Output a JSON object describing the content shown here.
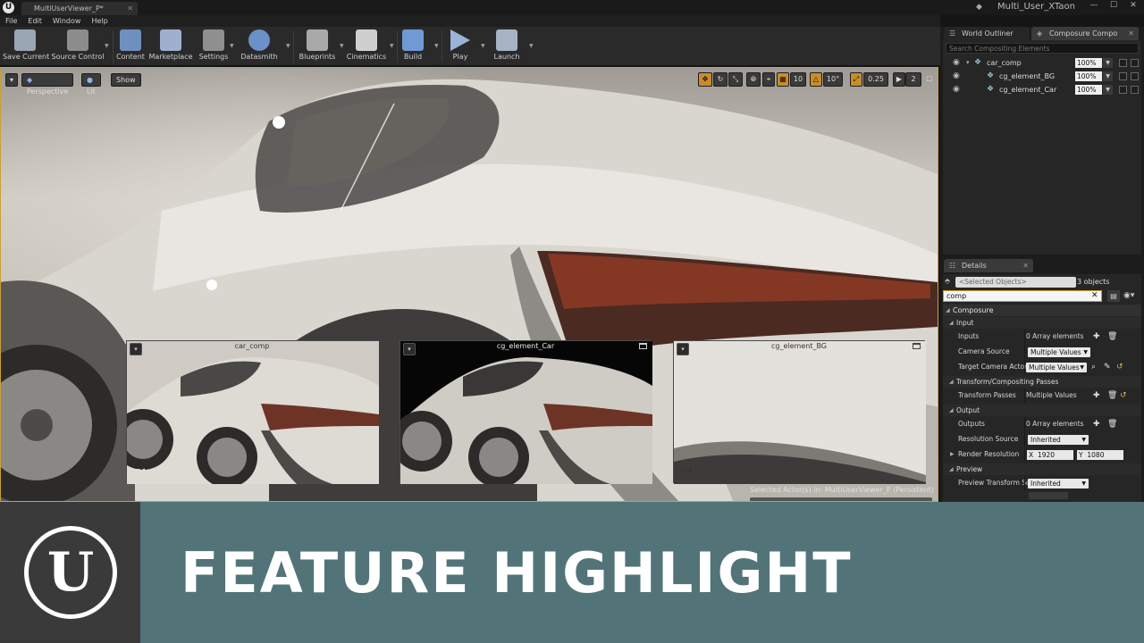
{
  "window": {
    "tab_title": "MultiUserViewer_P*",
    "project_name": "Multi_User_XTaon",
    "ue_logo": "U"
  },
  "menu": [
    "File",
    "Edit",
    "Window",
    "Help"
  ],
  "toolbar": {
    "buttons": [
      {
        "label": "Save Current",
        "icon": "save-icon",
        "color": "#9aa6b4"
      },
      {
        "label": "Source Control",
        "icon": "source-control-icon",
        "color": "#8c8c8c"
      },
      {
        "label": "Content",
        "icon": "content-icon",
        "color": "#6f8fbf"
      },
      {
        "label": "Marketplace",
        "icon": "marketplace-icon",
        "color": "#9fb0cf"
      },
      {
        "label": "Settings",
        "icon": "settings-icon",
        "color": "#8f8f8f"
      },
      {
        "label": "Datasmith",
        "icon": "datasmith-icon",
        "color": "#6c90c8"
      },
      {
        "label": "Blueprints",
        "icon": "blueprints-icon",
        "color": "#a9a9a9"
      },
      {
        "label": "Cinematics",
        "icon": "cinematics-icon",
        "color": "#cfcfcf"
      },
      {
        "label": "Build",
        "icon": "build-icon",
        "color": "#6f9ad6"
      },
      {
        "label": "Play",
        "icon": "play-icon",
        "color": "#9bb3d8"
      },
      {
        "label": "Launch",
        "icon": "launch-icon",
        "color": "#a5b3c4"
      }
    ]
  },
  "viewport": {
    "menu_glyph": "▾",
    "perspective": "Perspective",
    "lit": "Lit",
    "show": "Show",
    "grid_snap": "10",
    "rotate_snap": "10°",
    "scale_snap": "0.25",
    "camera_speed": "2",
    "selected_actor_text": "Selected Actor(s) in:  MultiUserViewer_P (Persistent)",
    "previews": [
      {
        "title": "car_comp",
        "dark": false
      },
      {
        "title": "cg_element_Car",
        "dark": true
      },
      {
        "title": "cg_element_BG",
        "dark": false
      }
    ]
  },
  "panels": {
    "world_outliner_tab": "World Outliner",
    "composure_tab": "Composure Compo",
    "search_placeholder": "Search Compositing Elements",
    "elements": [
      {
        "name": "car_comp",
        "opacity": "100%",
        "indent": 0
      },
      {
        "name": "cg_element_BG",
        "opacity": "100%",
        "indent": 1
      },
      {
        "name": "cg_element_Car",
        "opacity": "100%",
        "indent": 1
      }
    ],
    "details_tab": "Details",
    "selected_objects": "<Selected Objects>",
    "object_count": "3 objects",
    "filter_value": "comp",
    "details": {
      "category": "Composure",
      "input_header": "Input",
      "inputs_label": "Inputs",
      "inputs_value": "0 Array elements",
      "camera_source_label": "Camera Source",
      "camera_source_value": "Multiple Values",
      "target_camera_label": "Target Camera Actor",
      "target_camera_value": "Multiple Values",
      "transform_header": "Transform/Compositing Passes",
      "transform_passes_label": "Transform Passes",
      "transform_passes_value": "Multiple Values",
      "output_header": "Output",
      "outputs_label": "Outputs",
      "outputs_value": "0 Array elements",
      "resolution_source_label": "Resolution Source",
      "resolution_source_value": "Inherited",
      "render_resolution_label": "Render Resolution",
      "res_x_label": "X",
      "res_x": "1920",
      "res_y_label": "Y",
      "res_y": "1080",
      "preview_header": "Preview",
      "preview_transform_label": "Preview Transform So",
      "preview_transform_value": "Inherited"
    }
  },
  "banner": {
    "logo": "U",
    "title": "FEATURE HIGHLIGHT",
    "background": "#527479"
  }
}
